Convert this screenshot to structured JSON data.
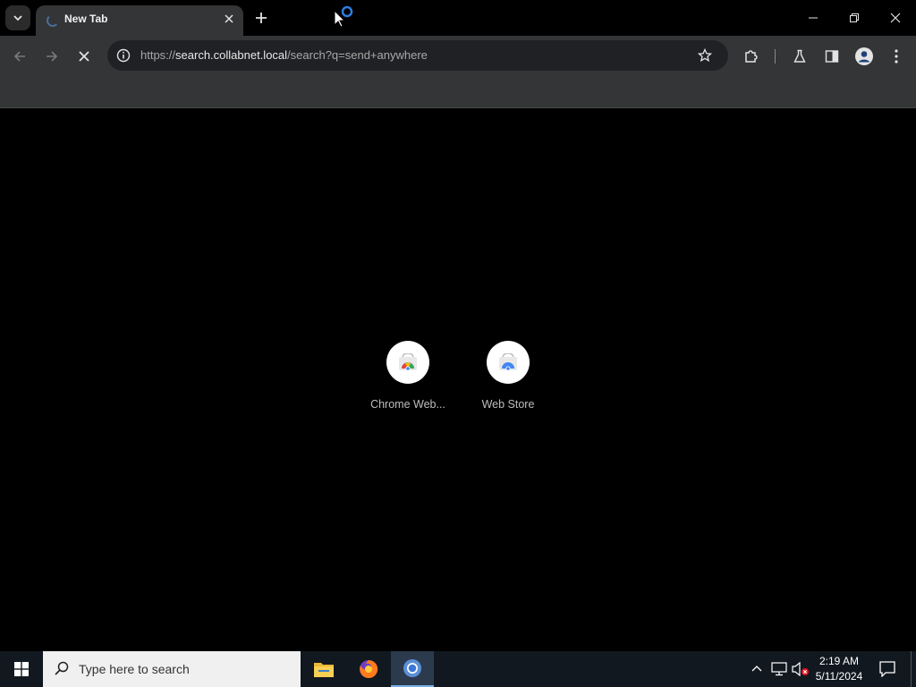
{
  "browser": {
    "tab": {
      "title": "New Tab"
    },
    "omnibox": {
      "scheme": "https://",
      "host": "search.collabnet.local",
      "path": "/search?q=send+anywhere"
    }
  },
  "shortcuts": [
    {
      "label": "Chrome Web..."
    },
    {
      "label": "Web Store"
    }
  ],
  "taskbar": {
    "search_placeholder": "Type here to search",
    "time": "2:19 AM",
    "date": "5/11/2024"
  },
  "colors": {
    "accent": "#7ab0e8",
    "background": "#000000",
    "toolbar": "#333536"
  }
}
